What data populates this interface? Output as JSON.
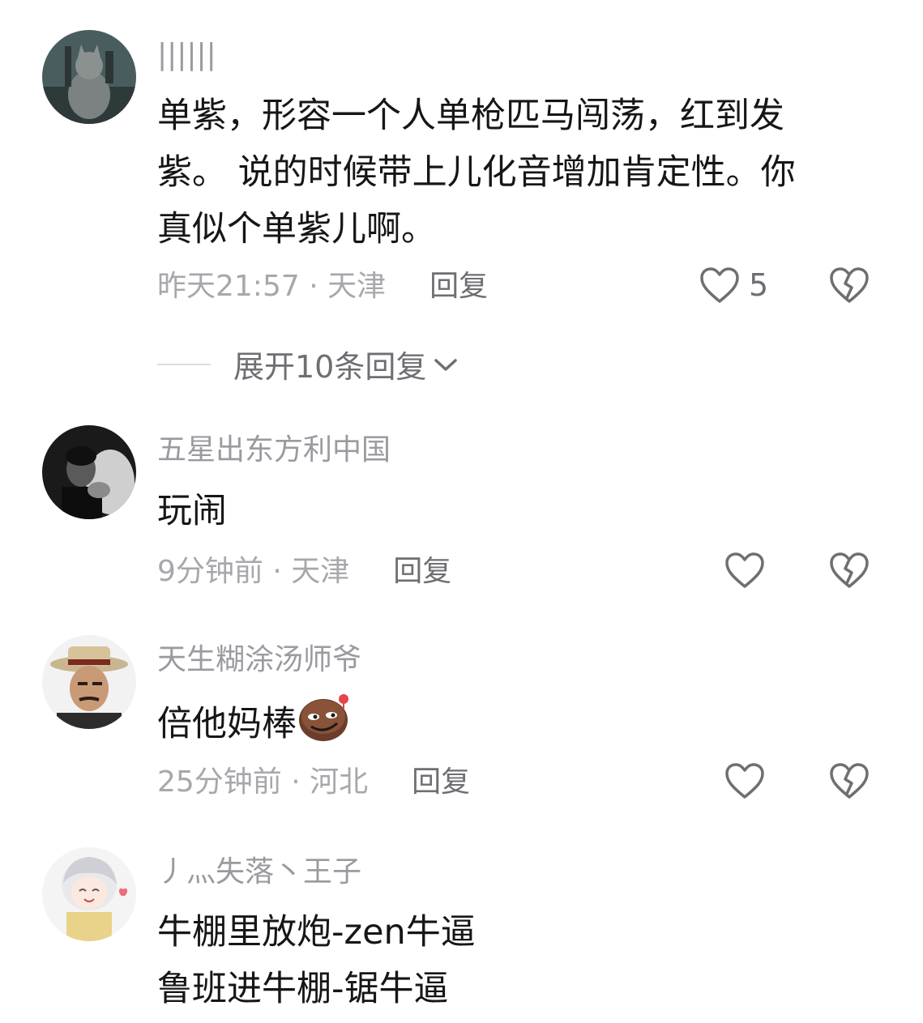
{
  "comments": [
    {
      "username": "||||||",
      "content_lines": [
        "单紫，形容一个人单枪匹马闯荡，红到发",
        "紫。 说的时候带上儿化音增加肯定性。你",
        "真似个单紫儿啊。"
      ],
      "time": "昨天21:57",
      "separator": " · ",
      "location": "天津",
      "reply_label": "回复",
      "like_count": "5",
      "expand_label": "展开10条回复"
    },
    {
      "username": "五星出东方利中国",
      "content_lines": [
        "玩闹"
      ],
      "time": "9分钟前",
      "separator": " · ",
      "location": "天津",
      "reply_label": "回复"
    },
    {
      "username": "天生糊涂汤师爷",
      "content_lines": [
        "倍他妈棒"
      ],
      "time": "25分钟前",
      "separator": " · ",
      "location": "河北",
      "reply_label": "回复"
    },
    {
      "username": "丿灬失落丶王子",
      "content_lines": [
        "牛棚里放炮-zen牛逼",
        "鲁班进牛棚-锯牛逼"
      ]
    }
  ],
  "icons": {
    "like": "heart-outline-icon",
    "dislike": "broken-heart-icon",
    "expand": "chevron-down-icon",
    "emoji": "smirk-emoji-icon"
  },
  "colors": {
    "username": "#9a9aa0",
    "content": "#161616",
    "meta": "#a7a7ac",
    "reply": "#6e6e73",
    "icon": "#6e6e73"
  }
}
